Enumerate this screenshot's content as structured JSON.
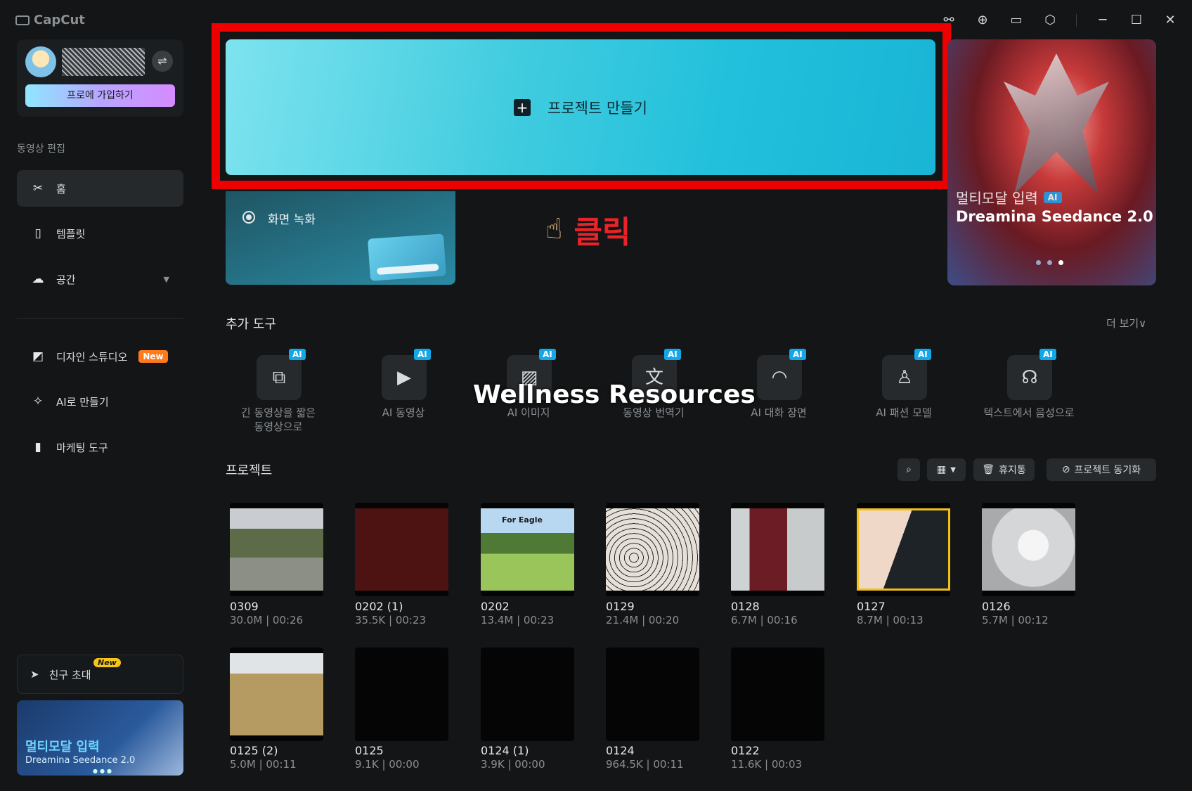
{
  "app": {
    "name": "CapCut"
  },
  "window_controls": [
    "share-icon",
    "upload-icon",
    "feedback-icon",
    "settings-icon",
    "minimize-icon",
    "maximize-icon",
    "close-icon"
  ],
  "profile": {
    "switch_glyph": "⇌",
    "pro_button": "프로에 가입하기"
  },
  "sidebar": {
    "section_label": "동영상 편집",
    "items": [
      {
        "label": "홈",
        "icon": "scissors-icon"
      },
      {
        "label": "템플릿",
        "icon": "template-icon"
      },
      {
        "label": "공간",
        "icon": "cloud-icon"
      }
    ],
    "extra": [
      {
        "label": "디자인 스튜디오",
        "icon": "design-icon",
        "badge": "New"
      },
      {
        "label": "AI로 만들기",
        "icon": "sparkle-icon"
      },
      {
        "label": "마케팅 도구",
        "icon": "marketing-icon"
      }
    ],
    "invite": {
      "label": "친구 초대",
      "badge": "New"
    },
    "promo": {
      "title": "멀티모달 입력",
      "subtitle": "Dreamina Seedance 2.0"
    }
  },
  "hero": {
    "create_label": "프로젝트 만들기",
    "record_label": "화면 녹화",
    "click_hint": "클릭"
  },
  "banner": {
    "title": "멀티모달 입력",
    "ai_badge": "AI",
    "subtitle": "Dreamina Seedance 2.0"
  },
  "tools": {
    "title": "추가 도구",
    "more": "더 보기",
    "items": [
      {
        "line1": "긴 동영상을 짧은",
        "line2": "동영상으로",
        "icon": "film-split-icon",
        "glyph": "⧉"
      },
      {
        "line1": "AI 동영상",
        "line2": "",
        "icon": "video-play-icon",
        "glyph": "▶"
      },
      {
        "line1": "AI 이미지",
        "line2": "",
        "icon": "image-sparkle-icon",
        "glyph": "▨"
      },
      {
        "line1": "동영상 번역기",
        "line2": "",
        "icon": "translate-icon",
        "glyph": "文"
      },
      {
        "line1": "AI 대화 장면",
        "line2": "",
        "icon": "lips-icon",
        "glyph": "◠"
      },
      {
        "line1": "AI 패션 모델",
        "line2": "",
        "icon": "shirt-icon",
        "glyph": "♙"
      },
      {
        "line1": "텍스트에서 음성으로",
        "line2": "",
        "icon": "voice-icon",
        "glyph": "☊"
      }
    ]
  },
  "watermark": "Wellness Resources",
  "projects": {
    "title": "프로젝트",
    "trash_label": "휴지통",
    "sync_label": "프로젝트 동기화",
    "items": [
      {
        "name": "0309",
        "meta": "30.0M | 00:26"
      },
      {
        "name": "0202 (1)",
        "meta": "35.5K | 00:23"
      },
      {
        "name": "0202",
        "meta": "13.4M | 00:23",
        "overlay": "For Eagle"
      },
      {
        "name": "0129",
        "meta": "21.4M | 00:20"
      },
      {
        "name": "0128",
        "meta": "6.7M | 00:16"
      },
      {
        "name": "0127",
        "meta": "8.7M | 00:13"
      },
      {
        "name": "0126",
        "meta": "5.7M | 00:12"
      },
      {
        "name": "0125 (2)",
        "meta": "5.0M | 00:11"
      },
      {
        "name": "0125",
        "meta": "9.1K | 00:00"
      },
      {
        "name": "0124 (1)",
        "meta": "3.9K | 00:00"
      },
      {
        "name": "0124",
        "meta": "964.5K | 00:11"
      },
      {
        "name": "0122",
        "meta": "11.6K | 00:03"
      }
    ]
  },
  "colors": {
    "accent_red": "#ee0000",
    "hero": "#22c0dc",
    "new_badge": "#ff7a1a",
    "ai_badge": "#11a7e8"
  }
}
